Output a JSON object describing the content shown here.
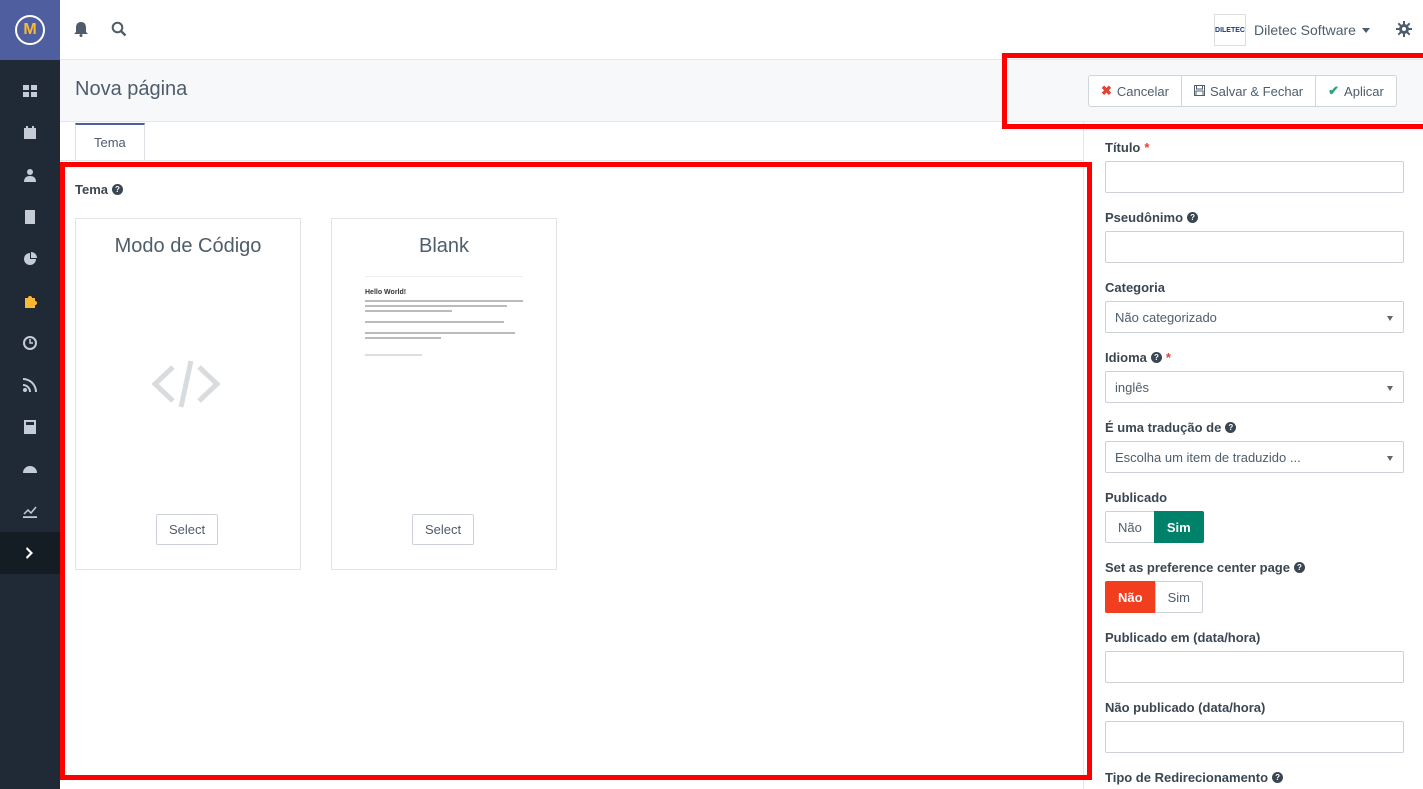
{
  "app": {
    "logo_letter": "M"
  },
  "company": {
    "logo_text": "DILETEC",
    "name": "Diletec Software"
  },
  "header": {
    "title": "Nova página",
    "cancel_label": "Cancelar",
    "save_close_label": "Salvar & Fechar",
    "apply_label": "Aplicar"
  },
  "tabs": [
    {
      "label": "Tema"
    }
  ],
  "theme": {
    "label": "Tema",
    "cards": [
      {
        "title": "Modo de Código",
        "select_label": "Select"
      },
      {
        "title": "Blank",
        "select_label": "Select",
        "preview_heading": "Hello World!"
      }
    ]
  },
  "form": {
    "title_label": "Título",
    "alias_label": "Pseudônimo",
    "category_label": "Categoria",
    "category_value": "Não categorizado",
    "language_label": "Idioma",
    "language_value": "inglês",
    "translation_label": "É uma tradução de",
    "translation_value": "Escolha um item de traduzido ...",
    "published_label": "Publicado",
    "published_no": "Não",
    "published_yes": "Sim",
    "pref_center_label": "Set as preference center page",
    "pref_no": "Não",
    "pref_yes": "Sim",
    "publish_up_label": "Publicado em (data/hora)",
    "publish_down_label": "Não publicado (data/hora)",
    "redirect_label": "Tipo de Redirecionamento"
  },
  "colors": {
    "sidebar": "#1f2a36",
    "accent": "#4e5e9e",
    "sim_green": "#00816a",
    "nao_red": "#f03e1e",
    "annotation": "#ff0000"
  }
}
